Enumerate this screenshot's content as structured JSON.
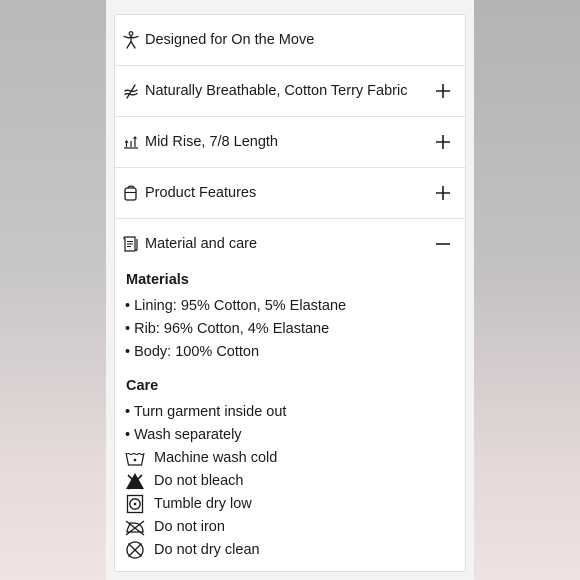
{
  "accordion": {
    "items": [
      {
        "label": "Designed for On the Move",
        "icon": "person-move-icon",
        "toggle": ""
      },
      {
        "label": "Naturally Breathable, Cotton Terry Fabric",
        "icon": "breathable-fabric-icon",
        "toggle": "+"
      },
      {
        "label": "Mid Rise, 7/8 Length",
        "icon": "rise-length-icon",
        "toggle": "+"
      },
      {
        "label": "Product Features",
        "icon": "product-features-icon",
        "toggle": "+"
      },
      {
        "label": "Material and care",
        "icon": "care-label-icon",
        "toggle": "−"
      }
    ]
  },
  "materials": {
    "heading": "Materials",
    "items": [
      "• Lining: 95% Cotton, 5% Elastane",
      "• Rib: 96% Cotton, 4% Elastane",
      "• Body: 100% Cotton"
    ]
  },
  "care": {
    "heading": "Care",
    "bullets": [
      "• Turn garment inside out",
      "• Wash separately"
    ],
    "symbols": [
      {
        "label": "Machine wash cold",
        "icon": "machine-wash-cold-icon"
      },
      {
        "label": "Do not bleach",
        "icon": "do-not-bleach-icon"
      },
      {
        "label": "Tumble dry low",
        "icon": "tumble-dry-low-icon"
      },
      {
        "label": "Do not iron",
        "icon": "do-not-iron-icon"
      },
      {
        "label": "Do not dry clean",
        "icon": "do-not-dry-clean-icon"
      }
    ]
  }
}
